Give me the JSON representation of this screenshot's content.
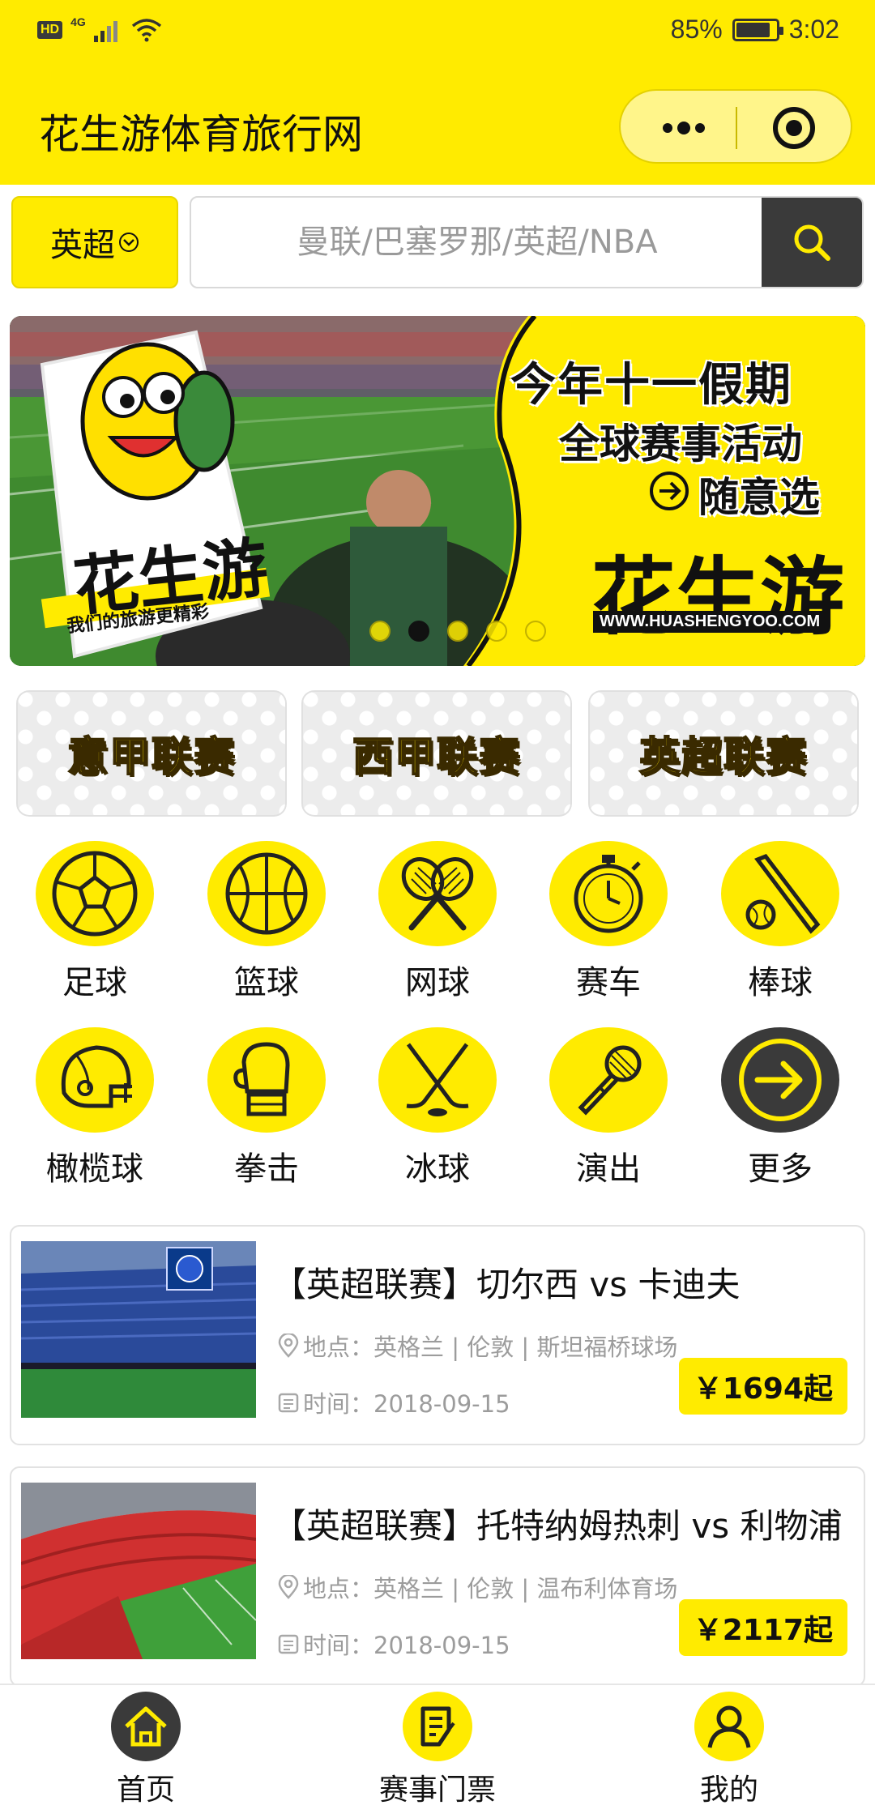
{
  "status_bar": {
    "hd": "HD",
    "network": "4G",
    "battery": "85%",
    "battery_level": 0.85,
    "time": "3:02"
  },
  "header": {
    "title": "花生游体育旅行网",
    "capsule_icons": [
      "more-dots-icon",
      "close-target-icon"
    ]
  },
  "search": {
    "category_label": "英超",
    "placeholder": "曼联/巴塞罗那/英超/NBA",
    "value": ""
  },
  "banner": {
    "line1": "今年十一假期",
    "line2": "全球赛事活动",
    "line3": "随意选",
    "brand": "花生游",
    "url": "WWW.HUASHENGYOO.COM",
    "sign_brand": "花生游",
    "sign_text": "我们的旅游更精彩",
    "dots": 5,
    "active_dot": 1,
    "accent": "#ffeb00"
  },
  "leagues": [
    {
      "label": "意甲联赛"
    },
    {
      "label": "西甲联赛"
    },
    {
      "label": "英超联赛"
    }
  ],
  "sports": [
    {
      "label": "足球",
      "icon": "soccer-ball-icon"
    },
    {
      "label": "篮球",
      "icon": "basketball-icon"
    },
    {
      "label": "网球",
      "icon": "tennis-rackets-icon"
    },
    {
      "label": "赛车",
      "icon": "stopwatch-icon"
    },
    {
      "label": "棒球",
      "icon": "baseball-bat-icon"
    },
    {
      "label": "橄榄球",
      "icon": "football-helmet-icon"
    },
    {
      "label": "拳击",
      "icon": "boxing-glove-icon"
    },
    {
      "label": "冰球",
      "icon": "hockey-sticks-icon"
    },
    {
      "label": "演出",
      "icon": "microphone-icon"
    },
    {
      "label": "更多",
      "icon": "arrow-right-icon"
    }
  ],
  "events": [
    {
      "title": "【英超联赛】切尔西 vs 卡迪夫",
      "location": "地点：英格兰 | 伦敦 | 斯坦福桥球场",
      "time": "时间：2018-09-15",
      "price": "￥1694起"
    },
    {
      "title": "【英超联赛】托特纳姆热刺 vs 利物浦",
      "location": "地点：英格兰 | 伦敦 | 温布利体育场",
      "time": "时间：2018-09-15",
      "price": "￥2117起"
    }
  ],
  "bottom_nav": [
    {
      "label": "首页",
      "icon": "home-icon",
      "active": true
    },
    {
      "label": "赛事门票",
      "icon": "ticket-icon",
      "active": false
    },
    {
      "label": "我的",
      "icon": "user-icon",
      "active": false
    }
  ],
  "colors": {
    "brand_yellow": "#ffeb00",
    "dark": "#3a3a3a",
    "muted_text": "#9c9c9c"
  }
}
